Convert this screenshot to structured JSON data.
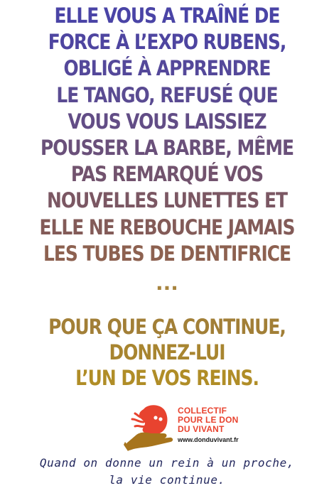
{
  "headline": {
    "lines": [
      {
        "text": "ELLE VOUS A TRAÎNÉ DE",
        "color": "#4a44a6"
      },
      {
        "text": "FORCE À L’EXPO RUBENS,",
        "color": "#4e45a0"
      },
      {
        "text": "OBLIGÉ À APPRENDRE",
        "color": "#54489a"
      },
      {
        "text": "LE TANGO, REFUSÉ QUE",
        "color": "#5a4b92"
      },
      {
        "text": "VOUS VOUS LAISSIEZ",
        "color": "#624d86"
      },
      {
        "text": "POUSSER LA BARBE, MÊME",
        "color": "#6a507a"
      },
      {
        "text": "PAS REMARQUÉ VOS",
        "color": "#72536e"
      },
      {
        "text": "NOUVELLES LUNETTES ET",
        "color": "#7b5763"
      },
      {
        "text": "ELLE NE REBOUCHE JAMAIS",
        "color": "#835b58"
      },
      {
        "text": "LES TUBES DE DENTIFRICE",
        "color": "#8d6150"
      }
    ],
    "ellipsis": "..."
  },
  "cta": {
    "lines": [
      {
        "text": "POUR QUE ÇA CONTINUE,",
        "color": "#a27f37"
      },
      {
        "text": "DONNEZ-LUI",
        "color": "#a88530"
      },
      {
        "text": "L’UN DE VOS REINS.",
        "color": "#b08d27"
      }
    ]
  },
  "logo": {
    "icon": "kidney-in-hand-icon",
    "lines": [
      "COLLECTIF",
      "POUR LE DON",
      "DU VIVANT"
    ],
    "url": "www.donduvivant.fr",
    "colors": {
      "kidney": "#e8432f",
      "hand": "#a7741c",
      "text": "#e8432f"
    }
  },
  "tagline": {
    "lines": [
      "Quand on donne un rein à un proche,",
      "la vie continue."
    ],
    "color": "#23285e"
  }
}
